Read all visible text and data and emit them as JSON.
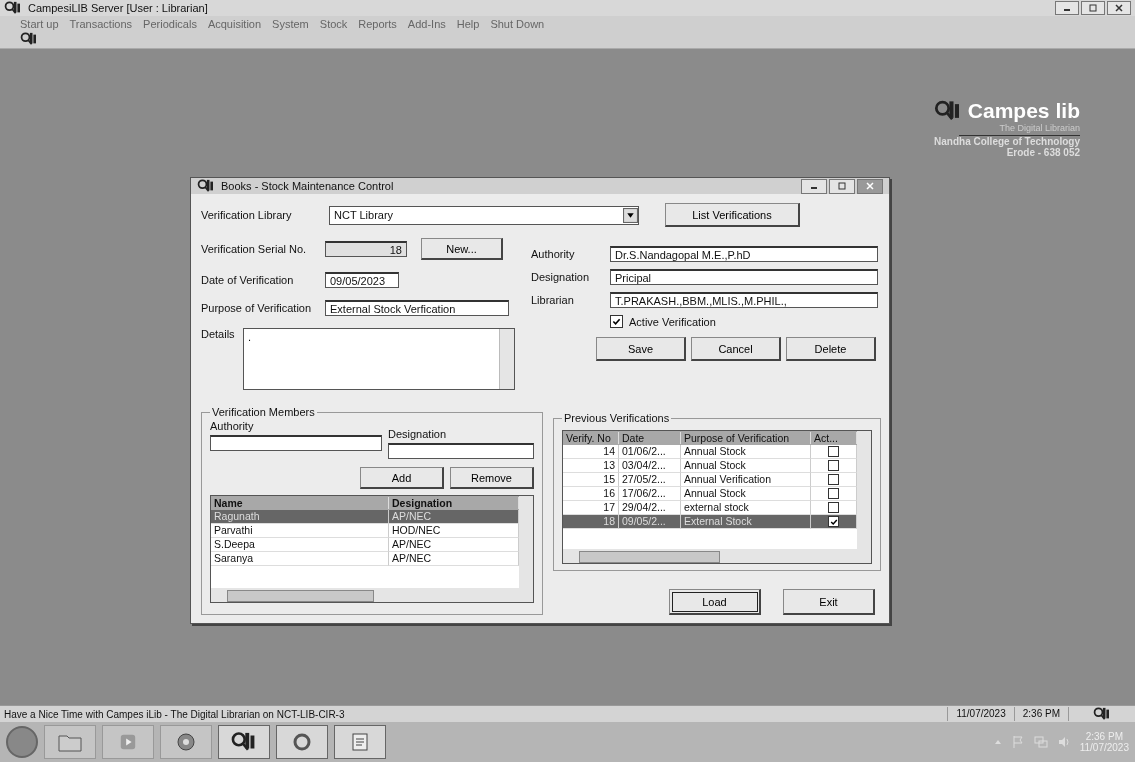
{
  "window": {
    "title": "CampesiLIB Server [User : Librarian]"
  },
  "menu": [
    "Start up",
    "Transactions",
    "Periodicals",
    "Acquisition",
    "System",
    "Stock",
    "Reports",
    "Add-Ins",
    "Help",
    "Shut Down"
  ],
  "logo": {
    "name": "Campes",
    "suffix": "lib",
    "tagline": "The Digital Librarian",
    "college": "Nandha College of Technology",
    "address": "Erode - 638 052"
  },
  "dialog": {
    "title": "Books - Stock Maintenance Control",
    "library_label": "Verification Library",
    "library_value": "NCT Library",
    "list_button": "List Verifications",
    "serial_label": "Verification Serial No.",
    "serial_value": "18",
    "new_button": "New...",
    "date_label": "Date of Verification",
    "date_value": "09/05/2023",
    "purpose_label": "Purpose of Verification",
    "purpose_value": "External Stock Verfication",
    "details_label": "Details",
    "details_value": ".",
    "authority_label": "Authority",
    "authority_value": "Dr.S.Nandagopal M.E.,P.hD",
    "designation_label": "Designation",
    "designation_value": "Pricipal",
    "librarian_label": "Librarian",
    "librarian_value": "T.PRAKASH.,BBM.,MLIS.,M.PHIL.,",
    "active": {
      "label": "Active Verification",
      "checked": true
    },
    "actions": [
      "Save",
      "Cancel",
      "Delete"
    ],
    "members": {
      "title": "Verification Members",
      "authority_label": "Authority",
      "designation_label": "Designation",
      "add_button": "Add",
      "remove_button": "Remove",
      "columns": [
        "Name",
        "Designation"
      ],
      "rows": [
        {
          "name": "Ragunath",
          "designation": "AP/NEC",
          "selected": true
        },
        {
          "name": "Parvathi",
          "designation": "HOD/NEC",
          "selected": false
        },
        {
          "name": "S.Deepa",
          "designation": "AP/NEC",
          "selected": false
        },
        {
          "name": "Saranya",
          "designation": "AP/NEC",
          "selected": false
        }
      ]
    },
    "previous": {
      "title": "Previous Verifications",
      "columns": [
        "Verify. No",
        "Date",
        "Purpose of Verification",
        "Act..."
      ],
      "rows": [
        {
          "no": "14",
          "date": "01/06/2...",
          "purpose": "Annual Stock",
          "active": false,
          "selected": false
        },
        {
          "no": "13",
          "date": "03/04/2...",
          "purpose": "Annual Stock",
          "active": false,
          "selected": false
        },
        {
          "no": "15",
          "date": "27/05/2...",
          "purpose": "Annual Verification",
          "active": false,
          "selected": false
        },
        {
          "no": "16",
          "date": "17/06/2...",
          "purpose": "Annual Stock",
          "active": false,
          "selected": false
        },
        {
          "no": "17",
          "date": "29/04/2...",
          "purpose": "external stock",
          "active": false,
          "selected": false
        },
        {
          "no": "18",
          "date": "09/05/2...",
          "purpose": "External Stock",
          "active": true,
          "selected": true
        }
      ]
    },
    "load_button": "Load",
    "exit_button": "Exit"
  },
  "status_bar": {
    "message": "Have a Nice Time with Campes iLib - The Digital Librarian on NCT-LIB-CIR-3",
    "date": "11/07/2023",
    "time": "2:36 PM"
  },
  "taskbar": {
    "time": "2:36 PM",
    "date": "11/07/2023"
  }
}
